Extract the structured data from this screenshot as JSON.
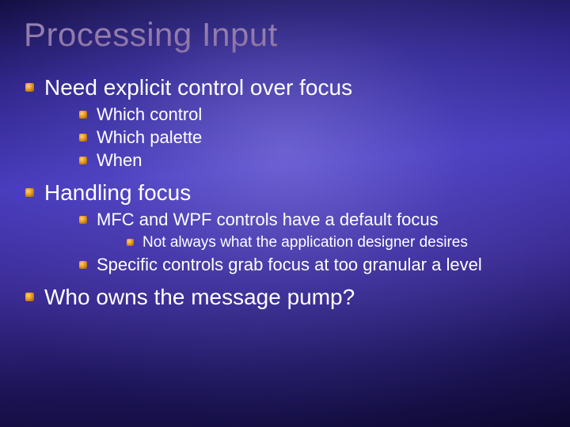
{
  "title": "Processing Input",
  "bullets": {
    "l1_a": "Need explicit control over focus",
    "l1_a_children": {
      "a": "Which control",
      "b": "Which palette",
      "c": "When"
    },
    "l1_b": "Handling focus",
    "l1_b_children": {
      "a": "MFC and WPF controls have a default focus",
      "a_children": {
        "a": "Not always what the application designer desires"
      },
      "b": "Specific controls grab focus at too granular a level"
    },
    "l1_c": "Who owns the message pump?"
  }
}
